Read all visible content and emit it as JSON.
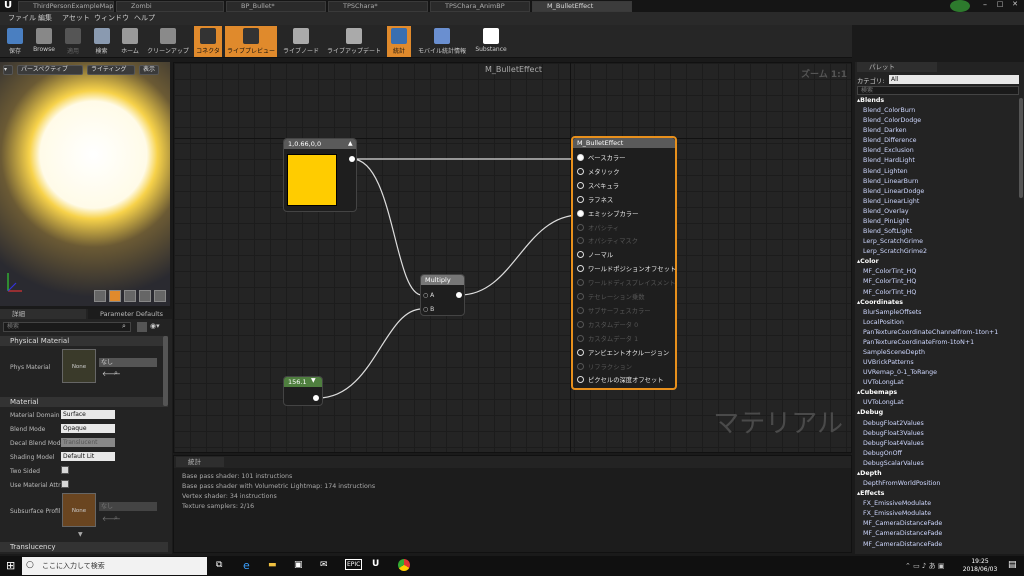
{
  "tabs": [
    "ThirdPersonExampleMap*",
    "Zombi",
    "BP_Bullet*",
    "TPSChara*",
    "TPSChara_AnimBP",
    "M_BulletEffect"
  ],
  "menu": [
    "ファイル",
    "編集",
    "アセット",
    "ウィンドウ",
    "ヘルプ"
  ],
  "toolbar": [
    {
      "label": "保存",
      "state": "normal",
      "color": "#4a7fc1"
    },
    {
      "label": "Browse",
      "state": "normal",
      "color": "#888"
    },
    {
      "label": "適用",
      "state": "disabled",
      "color": "#555"
    },
    {
      "label": "検索",
      "state": "normal",
      "color": "#8a9ab0"
    },
    {
      "label": "ホーム",
      "state": "normal",
      "color": "#9a9a9a"
    },
    {
      "label": "クリーンアップ",
      "state": "normal",
      "color": "#8a8a8a"
    },
    {
      "label": "コネクタ",
      "state": "on",
      "color": "#333"
    },
    {
      "label": "ライブプレビュー",
      "state": "on",
      "color": "#333"
    },
    {
      "label": "ライブノード",
      "state": "normal",
      "color": "#aaa"
    },
    {
      "label": "ライブアップデート",
      "state": "normal",
      "color": "#aaa"
    },
    {
      "label": "統計",
      "state": "on",
      "color": "#3a6fb0"
    },
    {
      "label": "モバイル統計情報",
      "state": "normal",
      "color": "#6a8fd0"
    },
    {
      "label": "Substance",
      "state": "normal",
      "color": "#fff"
    }
  ],
  "viewport": {
    "perspective": "パースペクティブ",
    "lighting": "ライティング",
    "show": "表示"
  },
  "details": {
    "tab1": "詳細",
    "tab2": "Parameter Defaults",
    "search_placeholder": "検索",
    "section_physical": "Physical Material",
    "phys_label": "Phys Material",
    "phys_thumb": "None",
    "phys_value": "なし",
    "section_material": "Material",
    "props": [
      {
        "label": "Material Domain",
        "value": "Surface",
        "disabled": false
      },
      {
        "label": "Blend Mode",
        "value": "Opaque",
        "disabled": false
      },
      {
        "label": "Decal Blend Mode",
        "value": "Translucent",
        "disabled": true
      },
      {
        "label": "Shading Model",
        "value": "Default Lit",
        "disabled": false
      }
    ],
    "two_sided": "Two Sided",
    "use_material_attr": "Use Material Attri",
    "subsurface_label": "Subsurface Profil",
    "subsurface_thumb": "None",
    "subsurface_value": "なし",
    "section_translucency": "Translucency"
  },
  "graph": {
    "title": "M_BulletEffect",
    "zoom": "ズーム 1:1",
    "watermark": "マテリアル",
    "color_node": {
      "title": "1,0.66,0,0",
      "color": "#ffcc00"
    },
    "multiply_node": {
      "title": "Multiply",
      "pin_a": "A",
      "pin_b": "B"
    },
    "scalar_node": {
      "title": "156.1"
    },
    "result_node": {
      "title": "M_BulletEffect",
      "pins": [
        {
          "label": "ベースカラー",
          "active": true,
          "connected": true
        },
        {
          "label": "メタリック",
          "active": true,
          "connected": false
        },
        {
          "label": "スペキュラ",
          "active": true,
          "connected": false
        },
        {
          "label": "ラフネス",
          "active": true,
          "connected": false
        },
        {
          "label": "エミッシブカラー",
          "active": true,
          "connected": true
        },
        {
          "label": "オパシティ",
          "active": false,
          "connected": false
        },
        {
          "label": "オパシティマスク",
          "active": false,
          "connected": false
        },
        {
          "label": "ノーマル",
          "active": true,
          "connected": false
        },
        {
          "label": "ワールドポジションオフセット",
          "active": true,
          "connected": false
        },
        {
          "label": "ワールドディスプレイスメント",
          "active": false,
          "connected": false
        },
        {
          "label": "テセレーション乗数",
          "active": false,
          "connected": false
        },
        {
          "label": "サブサーフェスカラー",
          "active": false,
          "connected": false
        },
        {
          "label": "カスタムデータ 0",
          "active": false,
          "connected": false
        },
        {
          "label": "カスタムデータ 1",
          "active": false,
          "connected": false
        },
        {
          "label": "アンビエントオクルージョン",
          "active": true,
          "connected": false
        },
        {
          "label": "リフラクション",
          "active": false,
          "connected": false
        },
        {
          "label": "ピクセルの深度オフセット",
          "active": true,
          "connected": false
        }
      ]
    }
  },
  "stats": {
    "tab": "統計",
    "lines": [
      "Base pass shader: 101 instructions",
      "Base pass shader with Volumetric Lightmap: 174 instructions",
      "Vertex shader: 34 instructions",
      "Texture samplers: 2/16"
    ]
  },
  "palette": {
    "tab": "パレット",
    "category_label": "カテゴリ:",
    "category_value": "All",
    "search_placeholder": "検索",
    "items": [
      {
        "text": "Blends",
        "cat": true
      },
      {
        "text": "Blend_ColorBurn"
      },
      {
        "text": "Blend_ColorDodge"
      },
      {
        "text": "Blend_Darken"
      },
      {
        "text": "Blend_Difference"
      },
      {
        "text": "Blend_Exclusion"
      },
      {
        "text": "Blend_HardLight"
      },
      {
        "text": "Blend_Lighten"
      },
      {
        "text": "Blend_LinearBurn"
      },
      {
        "text": "Blend_LinearDodge"
      },
      {
        "text": "Blend_LinearLight"
      },
      {
        "text": "Blend_Overlay"
      },
      {
        "text": "Blend_PinLight"
      },
      {
        "text": "Blend_SoftLight"
      },
      {
        "text": "Lerp_ScratchGrime"
      },
      {
        "text": "Lerp_ScratchGrime2"
      },
      {
        "text": "Color",
        "cat": true
      },
      {
        "text": "MF_ColorTint_HQ"
      },
      {
        "text": "MF_ColorTint_HQ"
      },
      {
        "text": "MF_ColorTint_HQ"
      },
      {
        "text": "Coordinates",
        "cat": true
      },
      {
        "text": "BlurSampleOffsets"
      },
      {
        "text": "LocalPosition"
      },
      {
        "text": "PanTextureCoordinateChannelfrom-1ton+1"
      },
      {
        "text": "PanTextureCoordinateFrom-1toN+1"
      },
      {
        "text": "SampleSceneDepth"
      },
      {
        "text": "UVBrickPatterns"
      },
      {
        "text": "UVRemap_0-1_ToRange"
      },
      {
        "text": "UVToLongLat"
      },
      {
        "text": "Cubemaps",
        "cat": true
      },
      {
        "text": "UVToLongLat"
      },
      {
        "text": "Debug",
        "cat": true
      },
      {
        "text": "DebugFloat2Values"
      },
      {
        "text": "DebugFloat3Values"
      },
      {
        "text": "DebugFloat4Values"
      },
      {
        "text": "DebugOnOff"
      },
      {
        "text": "DebugScalarValues"
      },
      {
        "text": "Depth",
        "cat": true
      },
      {
        "text": "DepthFromWorldPosition"
      },
      {
        "text": "Effects",
        "cat": true
      },
      {
        "text": "FX_EmissiveModulate"
      },
      {
        "text": "FX_EmissiveModulate"
      },
      {
        "text": "MF_CameraDistanceFade"
      },
      {
        "text": "MF_CameraDistanceFade"
      },
      {
        "text": "MF_CameraDistanceFade"
      }
    ]
  },
  "taskbar": {
    "search": "ここに入力して検索",
    "time": "19:25",
    "date": "2018/06/03"
  }
}
